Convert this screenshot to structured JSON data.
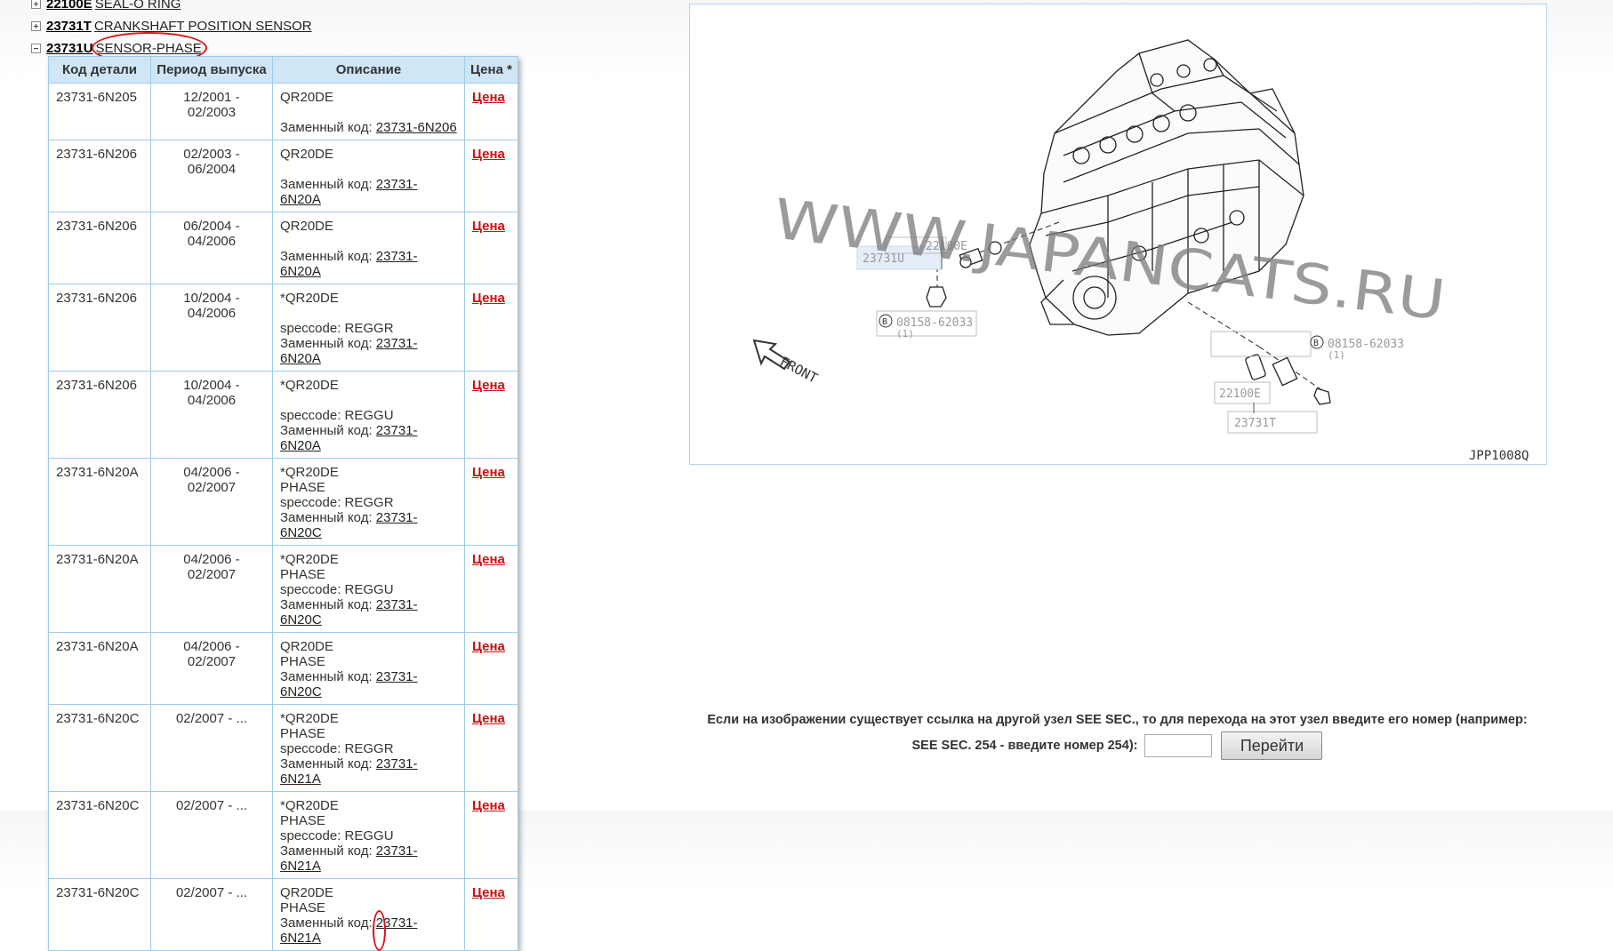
{
  "tree": [
    {
      "code": "22100E",
      "name": "SEAL-O RING",
      "expanded": false
    },
    {
      "code": "23731T",
      "name": "CRANKSHAFT POSITION SENSOR",
      "expanded": false
    },
    {
      "code": "23731U",
      "name": "SENSOR-PHASE",
      "expanded": true
    }
  ],
  "table": {
    "headers": [
      "Код детали",
      "Период выпуска",
      "Описание",
      "Цена *"
    ],
    "replacement_prefix": "Заменный код: ",
    "price_label": "Цена",
    "rows": [
      {
        "code": "23731-6N205",
        "period": "12/2001 - 02/2003",
        "desc": [
          "QR20DE",
          ""
        ],
        "repl": "23731-6N206"
      },
      {
        "code": "23731-6N206",
        "period": "02/2003 - 06/2004",
        "desc": [
          "QR20DE",
          ""
        ],
        "repl": "23731-6N20A"
      },
      {
        "code": "23731-6N206",
        "period": "06/2004 - 04/2006",
        "desc": [
          "QR20DE",
          ""
        ],
        "repl": "23731-6N20A"
      },
      {
        "code": "23731-6N206",
        "period": "10/2004 - 04/2006",
        "desc": [
          "*QR20DE",
          "",
          "speccode: REGGR"
        ],
        "repl": "23731-6N20A"
      },
      {
        "code": "23731-6N206",
        "period": "10/2004 - 04/2006",
        "desc": [
          "*QR20DE",
          "",
          "speccode: REGGU"
        ],
        "repl": "23731-6N20A"
      },
      {
        "code": "23731-6N20A",
        "period": "04/2006 - 02/2007",
        "desc": [
          "*QR20DE",
          "PHASE",
          "speccode: REGGR"
        ],
        "repl": "23731-6N20C"
      },
      {
        "code": "23731-6N20A",
        "period": "04/2006 - 02/2007",
        "desc": [
          "*QR20DE",
          "PHASE",
          "speccode: REGGU"
        ],
        "repl": "23731-6N20C"
      },
      {
        "code": "23731-6N20A",
        "period": "04/2006 - 02/2007",
        "desc": [
          "QR20DE",
          "PHASE"
        ],
        "repl": "23731-6N20C"
      },
      {
        "code": "23731-6N20C",
        "period": "02/2007 - ...",
        "desc": [
          "*QR20DE",
          "PHASE",
          "speccode: REGGR"
        ],
        "repl": "23731-6N21A"
      },
      {
        "code": "23731-6N20C",
        "period": "02/2007 - ...",
        "desc": [
          "*QR20DE",
          "PHASE",
          "speccode: REGGU"
        ],
        "repl": "23731-6N21A"
      },
      {
        "code": "23731-6N20C",
        "period": "02/2007 - ...",
        "desc": [
          "QR20DE",
          "PHASE"
        ],
        "repl": "23731-6N21A"
      }
    ]
  },
  "diagram": {
    "watermark": "WWW.JAPANCATS.RU",
    "labels": {
      "part_22100e_top": "22100E",
      "part_23731u": "23731U",
      "bolt_left": "08158-62033",
      "bolt_left_qty": "(1)",
      "bolt_right": "08158-62033",
      "bolt_right_qty": "(1)",
      "part_22100e_bottom": "22100E",
      "part_23731t": "23731T",
      "front": "FRONT",
      "ref": "JPP1008Q",
      "bolt_marker": "B"
    }
  },
  "see_sec": {
    "line1": "Если на изображении существует ссылка на другой узел SEE SEC., то для перехода на этот узел введите его номер (например:",
    "line2": "SEE SEC. 254 - введите номер 254):",
    "button": "Перейти"
  },
  "colors": {
    "header_bg": "#cfe6f7",
    "border": "#9fcbea",
    "price_red": "#cc1111",
    "annotation_red": "#d9141e"
  }
}
